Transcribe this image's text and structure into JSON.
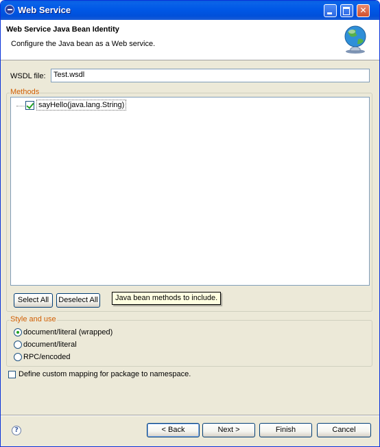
{
  "window": {
    "title": "Web Service"
  },
  "header": {
    "title": "Web Service Java Bean Identity",
    "description": "Configure the Java bean as a Web service."
  },
  "wsdl": {
    "label": "WSDL file:",
    "value": "Test.wsdl"
  },
  "methods": {
    "group_title": "Methods",
    "items": [
      {
        "label": "sayHello(java.lang.String)",
        "checked": true
      }
    ],
    "select_all_label": "Select All",
    "deselect_all_label": "Deselect All",
    "tooltip": "Java bean methods to include."
  },
  "style_use": {
    "group_title": "Style and use",
    "options": [
      {
        "label": "document/literal (wrapped)",
        "selected": true
      },
      {
        "label": "document/literal",
        "selected": false
      },
      {
        "label": "RPC/encoded",
        "selected": false
      }
    ]
  },
  "custom_mapping": {
    "label": "Define custom mapping for package to namespace.",
    "checked": false
  },
  "footer": {
    "help_glyph": "?",
    "back_label": "< Back",
    "next_label": "Next >",
    "finish_label": "Finish",
    "cancel_label": "Cancel"
  },
  "icons": [
    "app-icon",
    "minimize-icon",
    "maximize-icon",
    "close-icon",
    "globe-icon",
    "help-icon"
  ],
  "colors": {
    "titlebar": "#0058e6",
    "group_title": "#d15f04",
    "dialog_bg": "#ece9d8"
  }
}
